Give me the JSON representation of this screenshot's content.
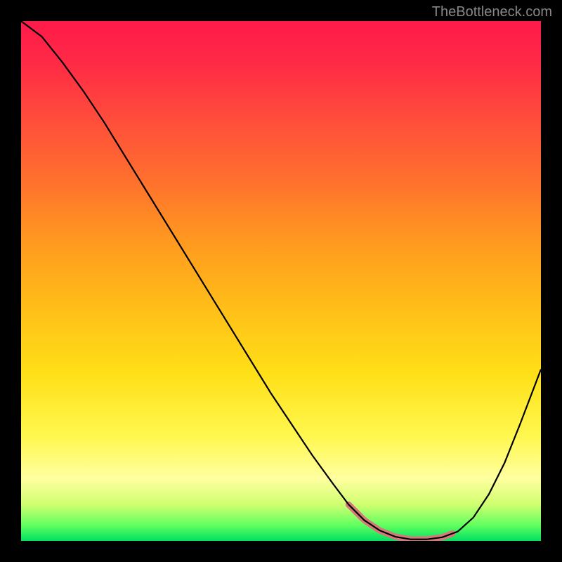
{
  "watermark": "TheBottleneck.com",
  "chart_data": {
    "type": "line",
    "title": "",
    "xlabel": "",
    "ylabel": "",
    "xlim": [
      0,
      100
    ],
    "ylim": [
      0,
      100
    ],
    "series": [
      {
        "name": "bottleneck-curve",
        "x": [
          0,
          4,
          8,
          12,
          16,
          20,
          24,
          28,
          32,
          36,
          40,
          44,
          48,
          52,
          56,
          60,
          63,
          66,
          69,
          72,
          75,
          78,
          81,
          84,
          87,
          90,
          93,
          96,
          100
        ],
        "values": [
          100,
          97,
          92,
          86.5,
          80.5,
          74,
          67.5,
          61,
          54.5,
          48,
          41.5,
          35,
          28.5,
          22.5,
          16.5,
          11,
          7,
          4,
          2,
          0.8,
          0.3,
          0.3,
          0.7,
          1.8,
          4.5,
          9,
          15,
          22.5,
          33
        ]
      }
    ],
    "annotations": [
      {
        "name": "optimal-band",
        "x_start": 63,
        "x_end": 83
      }
    ]
  }
}
